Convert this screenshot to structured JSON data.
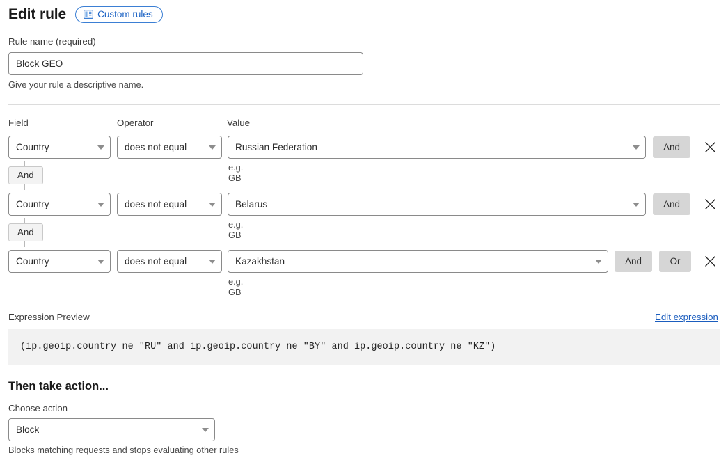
{
  "header": {
    "title": "Edit rule",
    "badge_label": "Custom rules",
    "badge_icon": "book-icon"
  },
  "rule_name": {
    "label": "Rule name (required)",
    "value": "Block GEO",
    "placeholder": "",
    "hint": "Give your rule a descriptive name."
  },
  "columns": {
    "field": "Field",
    "operator": "Operator",
    "value": "Value"
  },
  "conditions": [
    {
      "field": "Country",
      "operator": "does not equal",
      "value": "Russian Federation",
      "value_hint": "e.g. GB",
      "and_label": "And",
      "or_label": "",
      "remove_icon": "close-icon"
    },
    {
      "field": "Country",
      "operator": "does not equal",
      "value": "Belarus",
      "value_hint": "e.g. GB",
      "and_label": "And",
      "or_label": "",
      "remove_icon": "close-icon"
    },
    {
      "field": "Country",
      "operator": "does not equal",
      "value": "Kazakhstan",
      "value_hint": "e.g. GB",
      "and_label": "And",
      "or_label": "Or",
      "remove_icon": "close-icon"
    }
  ],
  "connectors": [
    {
      "label": "And"
    },
    {
      "label": "And"
    }
  ],
  "expression": {
    "label": "Expression Preview",
    "edit_link": "Edit expression",
    "text": "(ip.geoip.country ne \"RU\" and ip.geoip.country ne \"BY\" and ip.geoip.country ne \"KZ\")"
  },
  "action": {
    "section_title": "Then take action...",
    "label": "Choose action",
    "value": "Block",
    "hint": "Blocks matching requests and stops evaluating other rules"
  },
  "colors": {
    "accent": "#1b62c4",
    "link": "#1b5dbe",
    "gray_button": "#d6d6d6",
    "expression_bg": "#f2f2f2"
  }
}
